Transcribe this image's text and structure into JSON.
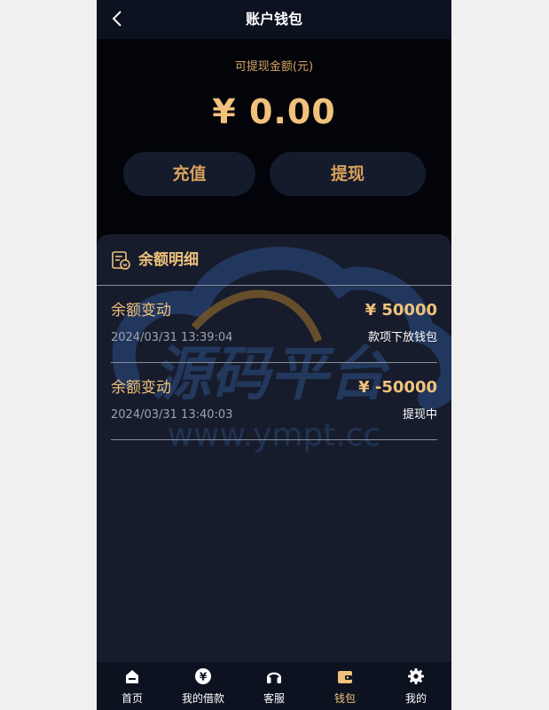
{
  "header": {
    "title": "账户钱包"
  },
  "balance": {
    "label": "可提现金额(元)",
    "amount": "¥ 0.00"
  },
  "actions": {
    "recharge_label": "充值",
    "withdraw_label": "提现"
  },
  "details": {
    "title": "余额明细",
    "records": [
      {
        "type": "余额变动",
        "amount": "¥ 50000",
        "time": "2024/03/31 13:39:04",
        "status": "款项下放钱包"
      },
      {
        "type": "余额变动",
        "amount": "¥ -50000",
        "time": "2024/03/31 13:40:03",
        "status": "提现中"
      }
    ]
  },
  "watermark": {
    "text": "源码平台",
    "url": "www.ympt.cc"
  },
  "tabbar": {
    "items": [
      {
        "label": "首页",
        "icon": "home-icon"
      },
      {
        "label": "我的借款",
        "icon": "yuan-coin-icon"
      },
      {
        "label": "客服",
        "icon": "headset-icon"
      },
      {
        "label": "钱包",
        "icon": "wallet-icon",
        "active": true
      },
      {
        "label": "我的",
        "icon": "gear-icon"
      }
    ]
  },
  "colors": {
    "accent": "#f0c27c",
    "button_text": "#d9a05b",
    "background": "#020409",
    "panel": "#171c2c",
    "bar": "#0d1221"
  }
}
